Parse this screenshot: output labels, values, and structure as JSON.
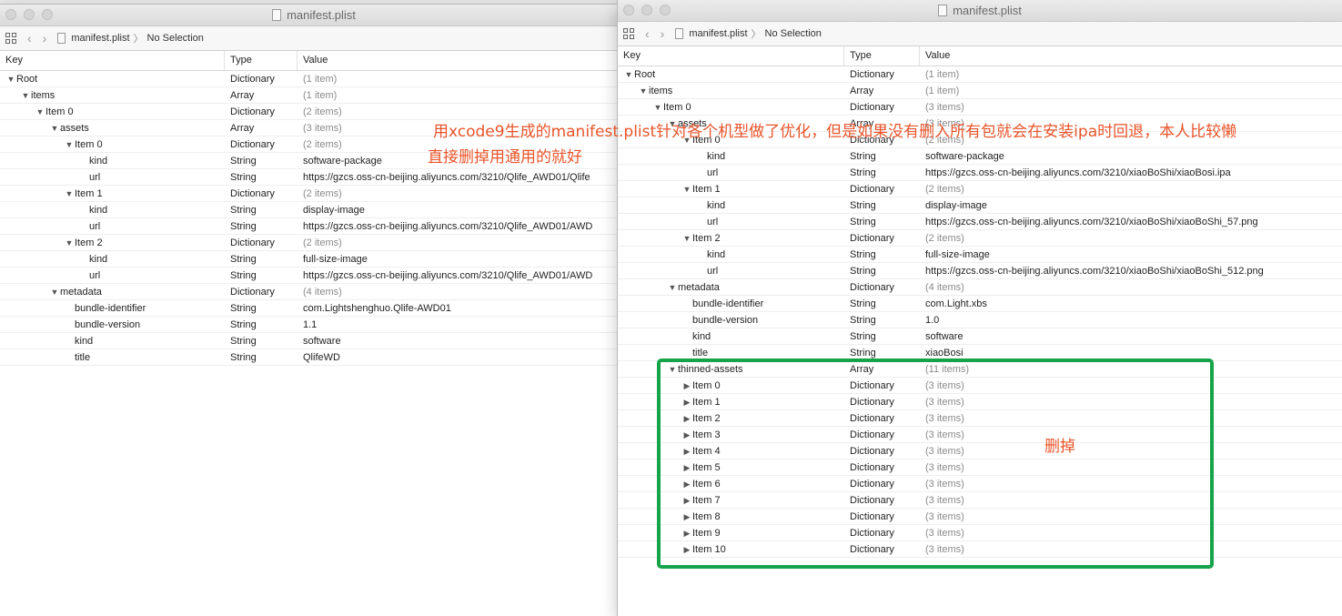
{
  "left_window": {
    "title": "manifest.plist",
    "breadcrumb": {
      "file": "manifest.plist",
      "selection": "No Selection"
    },
    "columns": {
      "key": "Key",
      "type": "Type",
      "value": "Value"
    },
    "rows": [
      {
        "depth": 0,
        "disc": "open",
        "key": "Root",
        "type": "Dictionary",
        "value": "(1 item)",
        "muted": true
      },
      {
        "depth": 1,
        "disc": "open",
        "key": "items",
        "type": "Array",
        "value": "(1 item)",
        "muted": true
      },
      {
        "depth": 2,
        "disc": "open",
        "key": "Item 0",
        "type": "Dictionary",
        "value": "(2 items)",
        "muted": true
      },
      {
        "depth": 3,
        "disc": "open",
        "key": "assets",
        "type": "Array",
        "value": "(3 items)",
        "muted": true
      },
      {
        "depth": 4,
        "disc": "open",
        "key": "Item 0",
        "type": "Dictionary",
        "value": "(2 items)",
        "muted": true
      },
      {
        "depth": 5,
        "disc": "none",
        "key": "kind",
        "type": "String",
        "value": "software-package",
        "muted": false
      },
      {
        "depth": 5,
        "disc": "none",
        "key": "url",
        "type": "String",
        "value": "https://gzcs.oss-cn-beijing.aliyuncs.com/3210/Qlife_AWD01/Qlife",
        "muted": false
      },
      {
        "depth": 4,
        "disc": "open",
        "key": "Item 1",
        "type": "Dictionary",
        "value": "(2 items)",
        "muted": true
      },
      {
        "depth": 5,
        "disc": "none",
        "key": "kind",
        "type": "String",
        "value": "display-image",
        "muted": false
      },
      {
        "depth": 5,
        "disc": "none",
        "key": "url",
        "type": "String",
        "value": "https://gzcs.oss-cn-beijing.aliyuncs.com/3210/Qlife_AWD01/AWD",
        "muted": false
      },
      {
        "depth": 4,
        "disc": "open",
        "key": "Item 2",
        "type": "Dictionary",
        "value": "(2 items)",
        "muted": true
      },
      {
        "depth": 5,
        "disc": "none",
        "key": "kind",
        "type": "String",
        "value": "full-size-image",
        "muted": false
      },
      {
        "depth": 5,
        "disc": "none",
        "key": "url",
        "type": "String",
        "value": "https://gzcs.oss-cn-beijing.aliyuncs.com/3210/Qlife_AWD01/AWD",
        "muted": false
      },
      {
        "depth": 3,
        "disc": "open",
        "key": "metadata",
        "type": "Dictionary",
        "value": "(4 items)",
        "muted": true
      },
      {
        "depth": 4,
        "disc": "none",
        "key": "bundle-identifier",
        "type": "String",
        "value": "com.Lightshenghuo.Qlife-AWD01",
        "muted": false
      },
      {
        "depth": 4,
        "disc": "none",
        "key": "bundle-version",
        "type": "String",
        "value": "1.1",
        "muted": false
      },
      {
        "depth": 4,
        "disc": "none",
        "key": "kind",
        "type": "String",
        "value": "software",
        "muted": false
      },
      {
        "depth": 4,
        "disc": "none",
        "key": "title",
        "type": "String",
        "value": "QlifeWD",
        "muted": false
      }
    ]
  },
  "right_window": {
    "title": "manifest.plist",
    "breadcrumb": {
      "file": "manifest.plist",
      "selection": "No Selection"
    },
    "columns": {
      "key": "Key",
      "type": "Type",
      "value": "Value"
    },
    "rows": [
      {
        "depth": 0,
        "disc": "open",
        "key": "Root",
        "type": "Dictionary",
        "value": "(1 item)",
        "muted": true
      },
      {
        "depth": 1,
        "disc": "open",
        "key": "items",
        "type": "Array",
        "value": "(1 item)",
        "muted": true
      },
      {
        "depth": 2,
        "disc": "open",
        "key": "Item 0",
        "type": "Dictionary",
        "value": "(3 items)",
        "muted": true
      },
      {
        "depth": 3,
        "disc": "open",
        "key": "assets",
        "type": "Array",
        "value": "(3 items)",
        "muted": true
      },
      {
        "depth": 4,
        "disc": "open",
        "key": "Item 0",
        "type": "Dictionary",
        "value": "(2 items)",
        "muted": true
      },
      {
        "depth": 5,
        "disc": "none",
        "key": "kind",
        "type": "String",
        "value": "software-package",
        "muted": false
      },
      {
        "depth": 5,
        "disc": "none",
        "key": "url",
        "type": "String",
        "value": "https://gzcs.oss-cn-beijing.aliyuncs.com/3210/xiaoBoShi/xiaoBosi.ipa",
        "muted": false
      },
      {
        "depth": 4,
        "disc": "open",
        "key": "Item 1",
        "type": "Dictionary",
        "value": "(2 items)",
        "muted": true
      },
      {
        "depth": 5,
        "disc": "none",
        "key": "kind",
        "type": "String",
        "value": "display-image",
        "muted": false
      },
      {
        "depth": 5,
        "disc": "none",
        "key": "url",
        "type": "String",
        "value": "https://gzcs.oss-cn-beijing.aliyuncs.com/3210/xiaoBoShi/xiaoBoShi_57.png",
        "muted": false
      },
      {
        "depth": 4,
        "disc": "open",
        "key": "Item 2",
        "type": "Dictionary",
        "value": "(2 items)",
        "muted": true
      },
      {
        "depth": 5,
        "disc": "none",
        "key": "kind",
        "type": "String",
        "value": "full-size-image",
        "muted": false
      },
      {
        "depth": 5,
        "disc": "none",
        "key": "url",
        "type": "String",
        "value": "https://gzcs.oss-cn-beijing.aliyuncs.com/3210/xiaoBoShi/xiaoBoShi_512.png",
        "muted": false
      },
      {
        "depth": 3,
        "disc": "open",
        "key": "metadata",
        "type": "Dictionary",
        "value": "(4 items)",
        "muted": true
      },
      {
        "depth": 4,
        "disc": "none",
        "key": "bundle-identifier",
        "type": "String",
        "value": "com.Light.xbs",
        "muted": false
      },
      {
        "depth": 4,
        "disc": "none",
        "key": "bundle-version",
        "type": "String",
        "value": "1.0",
        "muted": false
      },
      {
        "depth": 4,
        "disc": "none",
        "key": "kind",
        "type": "String",
        "value": "software",
        "muted": false
      },
      {
        "depth": 4,
        "disc": "none",
        "key": "title",
        "type": "String",
        "value": "xiaoBosi",
        "muted": false
      },
      {
        "depth": 3,
        "disc": "open",
        "key": "thinned-assets",
        "type": "Array",
        "value": "(11 items)",
        "muted": true
      },
      {
        "depth": 4,
        "disc": "closed",
        "key": "Item 0",
        "type": "Dictionary",
        "value": "(3 items)",
        "muted": true
      },
      {
        "depth": 4,
        "disc": "closed",
        "key": "Item 1",
        "type": "Dictionary",
        "value": "(3 items)",
        "muted": true
      },
      {
        "depth": 4,
        "disc": "closed",
        "key": "Item 2",
        "type": "Dictionary",
        "value": "(3 items)",
        "muted": true
      },
      {
        "depth": 4,
        "disc": "closed",
        "key": "Item 3",
        "type": "Dictionary",
        "value": "(3 items)",
        "muted": true
      },
      {
        "depth": 4,
        "disc": "closed",
        "key": "Item 4",
        "type": "Dictionary",
        "value": "(3 items)",
        "muted": true
      },
      {
        "depth": 4,
        "disc": "closed",
        "key": "Item 5",
        "type": "Dictionary",
        "value": "(3 items)",
        "muted": true
      },
      {
        "depth": 4,
        "disc": "closed",
        "key": "Item 6",
        "type": "Dictionary",
        "value": "(3 items)",
        "muted": true
      },
      {
        "depth": 4,
        "disc": "closed",
        "key": "Item 7",
        "type": "Dictionary",
        "value": "(3 items)",
        "muted": true
      },
      {
        "depth": 4,
        "disc": "closed",
        "key": "Item 8",
        "type": "Dictionary",
        "value": "(3 items)",
        "muted": true
      },
      {
        "depth": 4,
        "disc": "closed",
        "key": "Item 9",
        "type": "Dictionary",
        "value": "(3 items)",
        "muted": true
      },
      {
        "depth": 4,
        "disc": "closed",
        "key": "Item 10",
        "type": "Dictionary",
        "value": "(3 items)",
        "muted": true
      }
    ]
  },
  "annotations": {
    "line1": "用xcode9生成的manifest.plist针对各个机型做了优化，但是如果没有删入所有包就会在安装ipa时回退，本人比较懒",
    "line2": "直接删掉用通用的就好",
    "delete_label": "删掉",
    "text_color": "#e8542a",
    "box_color": "#16a34a"
  }
}
